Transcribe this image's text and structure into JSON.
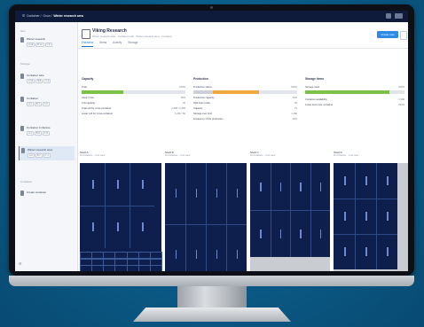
{
  "topbar": {
    "crumbs": [
      "Container",
      "Grow",
      "Winter research area"
    ]
  },
  "sidebar": {
    "section1": "Item",
    "section2": "Storage",
    "section3": "Container",
    "items": [
      {
        "title": "Winter research",
        "chips": [
          "A 12",
          "B 14",
          "C 8"
        ]
      },
      {
        "title": "Container tube",
        "chips": [
          "A 12",
          "B 8",
          "C 4"
        ]
      },
      {
        "title": "Container",
        "chips": [
          "A 4",
          "B 4",
          "C 6"
        ]
      },
      {
        "title": "Container 4 shelves",
        "chips": [
          "A 4",
          "B 6",
          "C 8"
        ]
      },
      {
        "title": "Winter research area",
        "chips": [
          "A 2",
          "B 2",
          "C 4"
        ]
      },
      {
        "title": "Create container",
        "chips": []
      }
    ]
  },
  "main": {
    "title": "Viking Research",
    "subtitle": "Winter research area · Container tube · Winter research area · Container",
    "cta": "Create new",
    "tabs": [
      "Overview",
      "Items",
      "Activity",
      "Storage"
    ],
    "panels": [
      {
        "title": "Capacity",
        "rows": [
          {
            "k": "Total",
            "v": "100%"
          },
          {
            "k": "Used / Free",
            "v": "40%"
          },
          {
            "k": "Unit capacity",
            "v": "20"
          },
          {
            "k": "Total cell for cross-container",
            "v": "2,300 / 2,400"
          },
          {
            "k": "Lower cell for cross-container",
            "v": "1,200 / 60"
          }
        ]
      },
      {
        "title": "Production",
        "rows": [
          {
            "k": "Production status",
            "v": "100%"
          },
          {
            "k": "Production capacity",
            "v": "2/10"
          },
          {
            "k": "Split lines under",
            "v": "20"
          },
          {
            "k": "Capacity",
            "v": "21"
          },
          {
            "k": "Storage over limit",
            "v": "1,400"
          },
          {
            "k": "Frequency of the production",
            "v": "40%"
          }
        ]
      },
      {
        "title": "Storage items",
        "rows": [
          {
            "k": "Storage used",
            "v": "100%"
          },
          {
            "k": "Container availability",
            "v": "1,300"
          },
          {
            "k": "Lower level over container",
            "v": "100%"
          }
        ]
      }
    ],
    "thumbs": [
      {
        "label": "Shelf A",
        "sub": "40 containers · 1 unit used"
      },
      {
        "label": "Shelf B",
        "sub": "40 containers · 1 unit used"
      },
      {
        "label": "Shelf C",
        "sub": "40 containers · 1 unit used"
      },
      {
        "label": "Shelf D",
        "sub": "40 containers · 1 unit used"
      }
    ],
    "progress": {
      "capacity_used": 0.4,
      "production_used": 0.55,
      "storage_used": 0.85
    }
  },
  "colors": {
    "accent": "#2d8be6",
    "rack": "#0e1f4d",
    "topbar": "#0f1b3a",
    "background": "#0b5b86"
  }
}
